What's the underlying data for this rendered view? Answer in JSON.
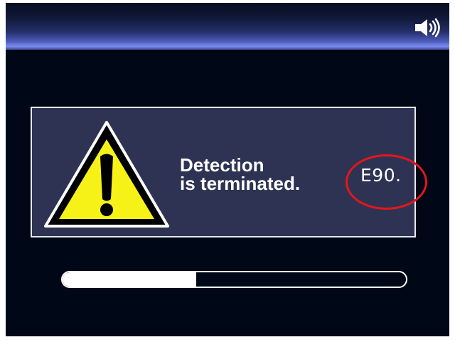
{
  "status_bar": {
    "speaker_icon": "speaker-volume-icon"
  },
  "dialog": {
    "warning_icon": "warning-triangle-icon",
    "message_line1": "Detection",
    "message_line2": "is terminated.",
    "error_code": "E90."
  },
  "progress": {
    "fraction": 0.39
  },
  "colors": {
    "background": "#000716",
    "dialog_fill": "#2f3353",
    "dialog_border": "#e6e8f2",
    "warning_yellow": "#f6f218",
    "highlight_red": "#e6151b",
    "text": "#ffffff"
  }
}
